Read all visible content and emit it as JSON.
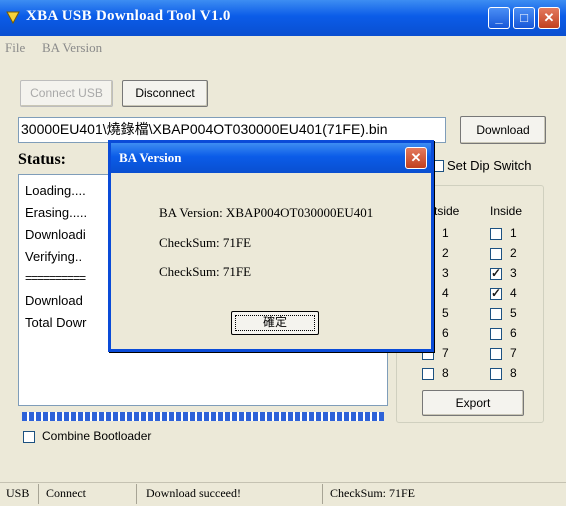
{
  "window": {
    "title": "XBA USB Download Tool V1.0",
    "minimize_glyph": "_",
    "maximize_glyph": "□",
    "close_glyph": "✕"
  },
  "menu": {
    "file": "File",
    "ba_version": "BA Version"
  },
  "toolbar": {
    "connect_usb": "Connect USB",
    "disconnect": "Disconnect"
  },
  "file_path": "30000EU401\\燒錄檔\\XBAP004OT030000EU401(71FE).bin",
  "download_button": "Download",
  "status_label": "Status:",
  "log": [
    "Loading....",
    "Erasing.....",
    "Downloadi",
    "Verifying..",
    "==========",
    "Download",
    "Total Dowr"
  ],
  "progress": 1.0,
  "combine_bootloader": {
    "label": "Combine Bootloader",
    "checked": false
  },
  "dip_switch": {
    "set_label": "Set Dip Switch",
    "group_title": "witch",
    "outside_header": "tside",
    "inside_header": "Inside",
    "rows": [
      {
        "num": "1",
        "inside_checked": false
      },
      {
        "num": "2",
        "inside_checked": false
      },
      {
        "num": "3",
        "inside_checked": true
      },
      {
        "num": "4",
        "inside_checked": true
      },
      {
        "num": "5",
        "inside_checked": false
      },
      {
        "num": "6",
        "inside_checked": false
      },
      {
        "num": "7",
        "inside_checked": false
      },
      {
        "num": "8",
        "inside_checked": false
      }
    ],
    "export_button": "Export"
  },
  "statusbar": {
    "usb": "USB",
    "connect": "Connect",
    "message": "Download succeed!",
    "checksum": "CheckSum: 71FE"
  },
  "dialog": {
    "title": "BA Version",
    "close_glyph": "✕",
    "line1": "BA Version: XBAP004OT030000EU401",
    "line2": "CheckSum: 71FE",
    "line3": "CheckSum: 71FE",
    "ok": "確定"
  },
  "colors": {
    "titlebar": "#0b5ce8",
    "progress": "#2e62d8",
    "window_bg": "#ece9d8"
  }
}
